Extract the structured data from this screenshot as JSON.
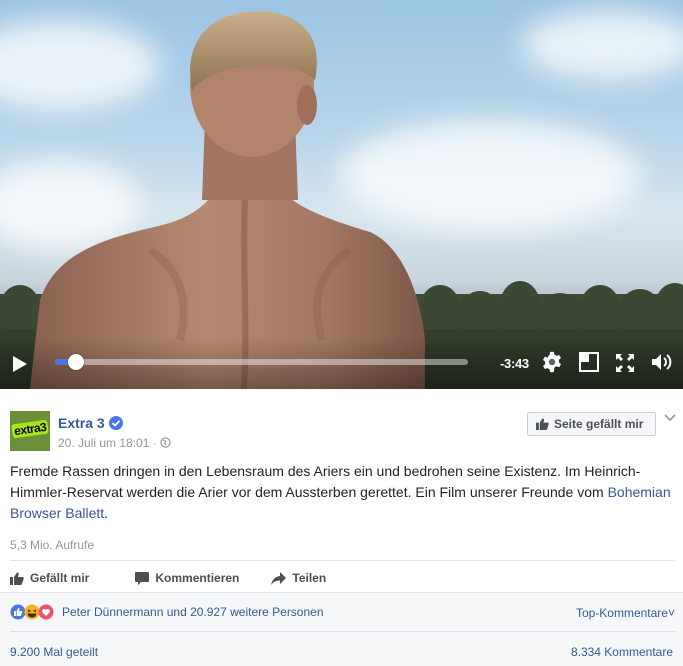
{
  "video": {
    "time_remaining": "-3:43",
    "progress": 0.05
  },
  "post": {
    "page_name": "Extra 3",
    "avatar_text": "extra3",
    "date": "20. Juli um 18:01",
    "meta_separator": "·",
    "like_page_label": "Seite gefällt mir",
    "text_main": "Fremde Rassen dringen in den Lebensraum des Ariers ein und bedrohen seine Existenz. Im Heinrich-Himmler-Reservat werden die Arier vor dem Aussterben gerettet. Ein Film unserer Freunde vom ",
    "text_link": "Bohemian Browser Ballett",
    "text_end": ".",
    "views": "5,3 Mio. Aufrufe",
    "actions": {
      "like": "Gefällt mir",
      "comment": "Kommentieren",
      "share": "Teilen"
    },
    "reactions_text": "Peter Dünnermann und 20.927 weitere Personen",
    "top_comments": "Top-Kommentare",
    "top_comments_caret": "˅",
    "shares": "9.200 Mal geteilt",
    "comments_count": "8.334 Kommentare"
  },
  "colors": {
    "link": "#365899",
    "accent": "#4a76e8",
    "muted": "#90949c"
  }
}
